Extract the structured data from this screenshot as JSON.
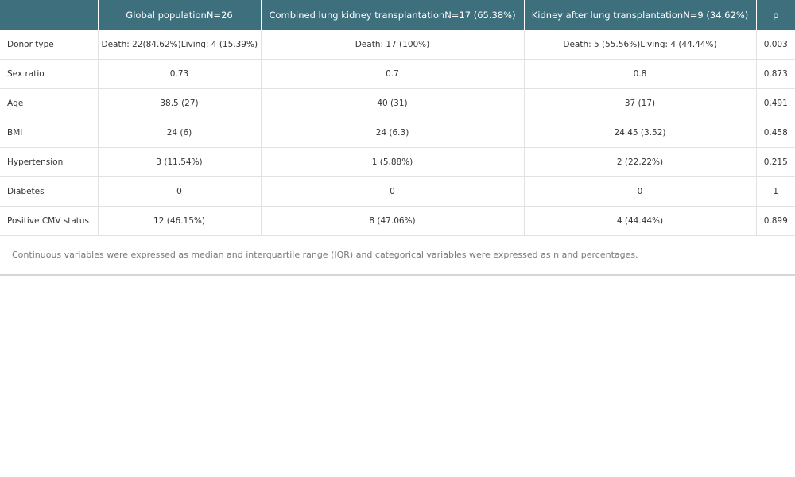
{
  "table": {
    "headers": [
      "",
      "Global populationN=26",
      "Combined lung kidney transplantationN=17 (65.38%)",
      "Kidney after lung transplantationN=9 (34.62%)",
      "p"
    ],
    "rows": [
      [
        "Donor type",
        "Death: 22(84.62%)Living: 4 (15.39%)",
        "Death: 17 (100%)",
        "Death: 5 (55.56%)Living: 4 (44.44%)",
        "0.003"
      ],
      [
        "Sex ratio",
        "0.73",
        "0.7",
        "0.8",
        "0.873"
      ],
      [
        "Age",
        "38.5 (27)",
        "40 (31)",
        "37 (17)",
        "0.491"
      ],
      [
        "BMI",
        "24 (6)",
        "24 (6.3)",
        "24.45 (3.52)",
        "0.458"
      ],
      [
        "Hypertension",
        "3 (11.54%)",
        "1 (5.88%)",
        "2 (22.22%)",
        "0.215"
      ],
      [
        "Diabetes",
        "0",
        "0",
        "0",
        "1"
      ],
      [
        "Positive CMV status",
        "12 (46.15%)",
        "8 (47.06%)",
        "4 (44.44%)",
        "0.899"
      ]
    ]
  },
  "footnote": "Continuous variables were expressed as median and interquartile range (IQR) and categorical variables were expressed as n and percentages.",
  "colors": {
    "header_bg": "#3d6f7d",
    "header_text": "#ffffff",
    "border": "#e2e2e2"
  }
}
